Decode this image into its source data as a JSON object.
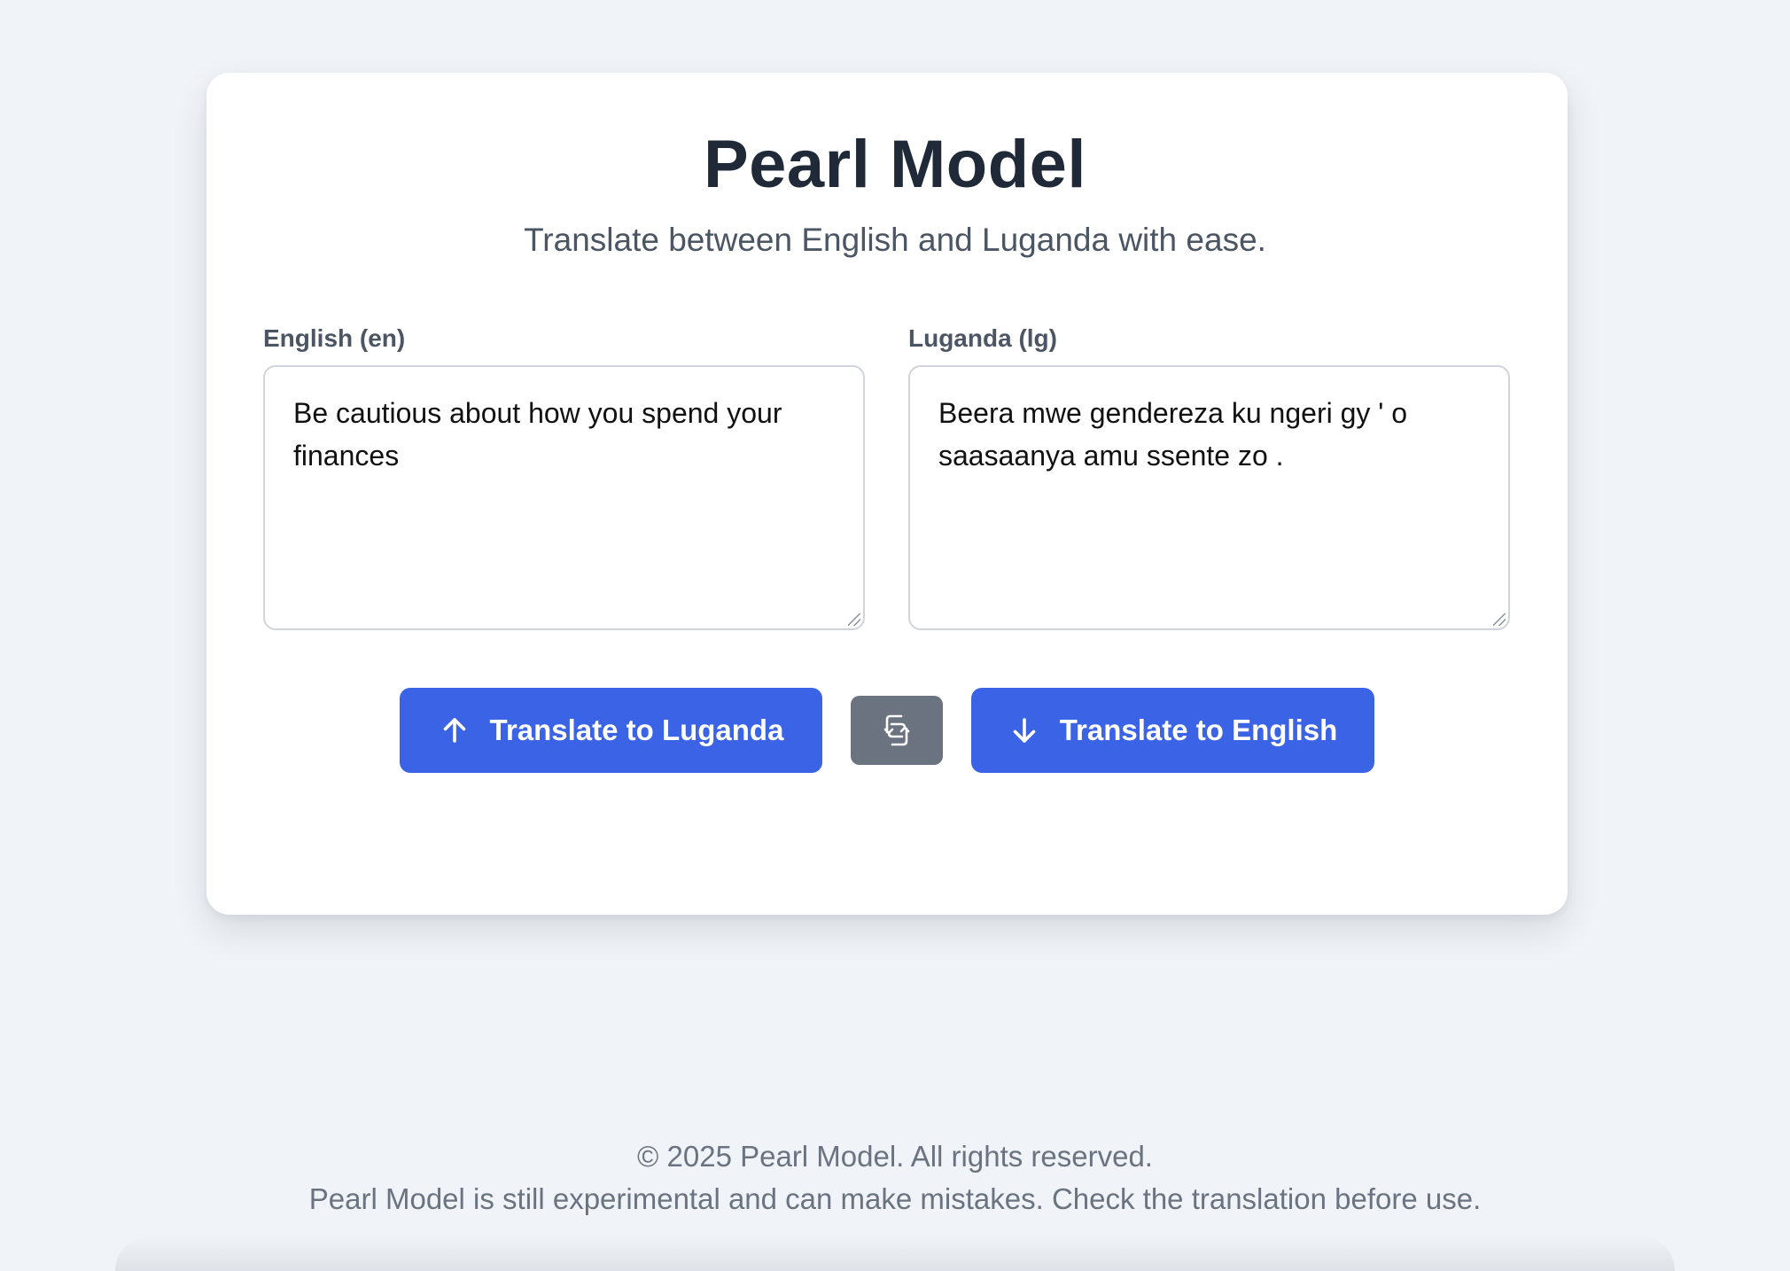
{
  "header": {
    "title": "Pearl Model",
    "subtitle": "Translate between English and Luganda with ease."
  },
  "english_panel": {
    "label": "English (en)",
    "value": "Be cautious about how you spend your finances"
  },
  "luganda_panel": {
    "label": "Luganda (lg)",
    "value": "Beera mwe gendereza ku ngeri gy ' o saasaanya amu ssente zo ."
  },
  "actions": {
    "to_luganda_label": "Translate to Luganda",
    "to_luganda_icon": "arrow-up-icon",
    "swap_icon": "swap-icon",
    "to_english_label": "Translate to English",
    "to_english_icon": "arrow-down-icon"
  },
  "footer": {
    "copyright": "© 2025 Pearl Model. All rights reserved.",
    "disclaimer": "Pearl Model is still experimental and can make mistakes. Check the translation before use."
  },
  "colors": {
    "background": "#f0f4f8",
    "card": "#ffffff",
    "primary_button": "#3b63e6",
    "secondary_button": "#6b7280",
    "title_text": "#1f2937",
    "muted_text": "#4b5563"
  }
}
